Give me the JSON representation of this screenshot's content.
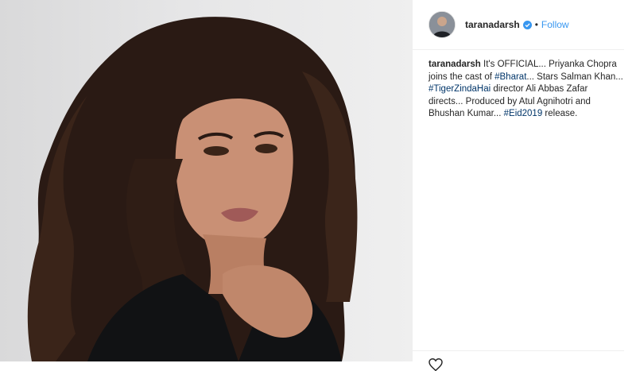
{
  "post": {
    "username": "taranadarsh",
    "follow_label": "Follow",
    "separator": "•",
    "caption": {
      "text_1": "It's OFFICIAL... Priyanka Chopra joins the cast of ",
      "tag_1": "#Bharat",
      "text_2": "... Stars Salman Khan... ",
      "tag_2": "#TigerZindaHai",
      "text_3": " director Ali Abbas Zafar directs... Produced by Atul Agnihotri and Bhushan Kumar... ",
      "tag_3": "#Eid2019",
      "text_4": " release."
    }
  },
  "icons": {
    "verified": "verified-badge-icon",
    "like": "heart-icon"
  },
  "colors": {
    "link_blue": "#3897f0",
    "hashtag": "#003569",
    "verified": "#3897f0"
  }
}
